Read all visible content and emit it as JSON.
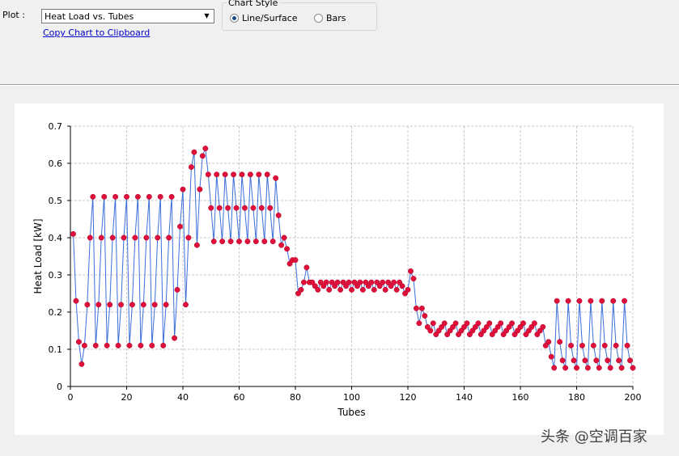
{
  "controls": {
    "plot_label": "Plot :",
    "plot_select_value": "Heat Load vs. Tubes",
    "copy_link": "Copy Chart to Clipboard",
    "chart_style_title": "Chart Style",
    "style_options": [
      "Line/Surface",
      "Bars"
    ],
    "style_selected": "Line/Surface"
  },
  "watermark": "头条 @空调百家",
  "colors": {
    "line": "#3a6fd8",
    "marker": "#e0103c",
    "grid": "#c8c8c8"
  },
  "chart_data": {
    "type": "line",
    "xlabel": "Tubes",
    "ylabel": "Heat Load [kW]",
    "xlim": [
      0,
      200
    ],
    "ylim": [
      0,
      0.7
    ],
    "xticks": [
      "0",
      "20",
      "40",
      "60",
      "80",
      "100",
      "120",
      "140",
      "160",
      "180",
      "200"
    ],
    "yticks": [
      "0",
      "0.1",
      "0.2",
      "0.3",
      "0.4",
      "0.5",
      "0.6",
      "0.7"
    ],
    "grid": true,
    "x": [
      1,
      2,
      3,
      4,
      5,
      6,
      7,
      8,
      9,
      10,
      11,
      12,
      13,
      14,
      15,
      16,
      17,
      18,
      19,
      20,
      21,
      22,
      23,
      24,
      25,
      26,
      27,
      28,
      29,
      30,
      31,
      32,
      33,
      34,
      35,
      36,
      37,
      38,
      39,
      40,
      41,
      42,
      43,
      44,
      45,
      46,
      47,
      48,
      49,
      50,
      51,
      52,
      53,
      54,
      55,
      56,
      57,
      58,
      59,
      60,
      61,
      62,
      63,
      64,
      65,
      66,
      67,
      68,
      69,
      70,
      71,
      72,
      73,
      74,
      75,
      76,
      77,
      78,
      79,
      80,
      81,
      82,
      83,
      84,
      85,
      86,
      87,
      88,
      89,
      90,
      91,
      92,
      93,
      94,
      95,
      96,
      97,
      98,
      99,
      100,
      101,
      102,
      103,
      104,
      105,
      106,
      107,
      108,
      109,
      110,
      111,
      112,
      113,
      114,
      115,
      116,
      117,
      118,
      119,
      120,
      121,
      122,
      123,
      124,
      125,
      126,
      127,
      128,
      129,
      130,
      131,
      132,
      133,
      134,
      135,
      136,
      137,
      138,
      139,
      140,
      141,
      142,
      143,
      144,
      145,
      146,
      147,
      148,
      149,
      150,
      151,
      152,
      153,
      154,
      155,
      156,
      157,
      158,
      159,
      160,
      161,
      162,
      163,
      164,
      165,
      166,
      167,
      168,
      169,
      170,
      171,
      172,
      173,
      174,
      175,
      176,
      177,
      178,
      179,
      180,
      181,
      182,
      183,
      184,
      185,
      186,
      187,
      188,
      189,
      190,
      191,
      192,
      193,
      194,
      195,
      196,
      197,
      198,
      199,
      200
    ],
    "y": [
      0.41,
      0.23,
      0.12,
      0.06,
      0.11,
      0.22,
      0.4,
      0.51,
      0.11,
      0.22,
      0.4,
      0.51,
      0.11,
      0.22,
      0.4,
      0.51,
      0.11,
      0.22,
      0.4,
      0.51,
      0.11,
      0.22,
      0.4,
      0.51,
      0.11,
      0.22,
      0.4,
      0.51,
      0.11,
      0.22,
      0.4,
      0.51,
      0.11,
      0.22,
      0.4,
      0.51,
      0.13,
      0.26,
      0.43,
      0.53,
      0.22,
      0.4,
      0.59,
      0.63,
      0.38,
      0.53,
      0.62,
      0.64,
      0.57,
      0.48,
      0.39,
      0.57,
      0.48,
      0.39,
      0.57,
      0.48,
      0.39,
      0.57,
      0.48,
      0.39,
      0.57,
      0.48,
      0.39,
      0.57,
      0.48,
      0.39,
      0.57,
      0.48,
      0.39,
      0.57,
      0.48,
      0.39,
      0.56,
      0.46,
      0.38,
      0.4,
      0.37,
      0.33,
      0.34,
      0.34,
      0.25,
      0.26,
      0.28,
      0.32,
      0.28,
      0.28,
      0.27,
      0.26,
      0.28,
      0.27,
      0.28,
      0.26,
      0.28,
      0.27,
      0.28,
      0.26,
      0.28,
      0.27,
      0.28,
      0.26,
      0.28,
      0.27,
      0.28,
      0.26,
      0.28,
      0.27,
      0.28,
      0.26,
      0.28,
      0.27,
      0.28,
      0.26,
      0.28,
      0.27,
      0.28,
      0.26,
      0.28,
      0.27,
      0.25,
      0.26,
      0.31,
      0.29,
      0.21,
      0.17,
      0.21,
      0.19,
      0.16,
      0.15,
      0.17,
      0.14,
      0.15,
      0.16,
      0.17,
      0.14,
      0.15,
      0.16,
      0.17,
      0.14,
      0.15,
      0.16,
      0.17,
      0.14,
      0.15,
      0.16,
      0.17,
      0.14,
      0.15,
      0.16,
      0.17,
      0.14,
      0.15,
      0.16,
      0.17,
      0.14,
      0.15,
      0.16,
      0.17,
      0.14,
      0.15,
      0.16,
      0.17,
      0.14,
      0.15,
      0.16,
      0.17,
      0.14,
      0.15,
      0.16,
      0.11,
      0.12,
      0.08,
      0.05,
      0.23,
      0.12,
      0.07,
      0.05,
      0.23,
      0.11,
      0.07,
      0.05,
      0.23,
      0.11,
      0.07,
      0.05,
      0.23,
      0.11,
      0.07,
      0.05,
      0.23,
      0.11,
      0.07,
      0.05,
      0.23,
      0.11,
      0.07,
      0.05,
      0.23,
      0.11,
      0.07,
      0.05,
      0.23,
      0.23,
      0.11,
      0.05,
      0.05,
      0.05
    ]
  }
}
